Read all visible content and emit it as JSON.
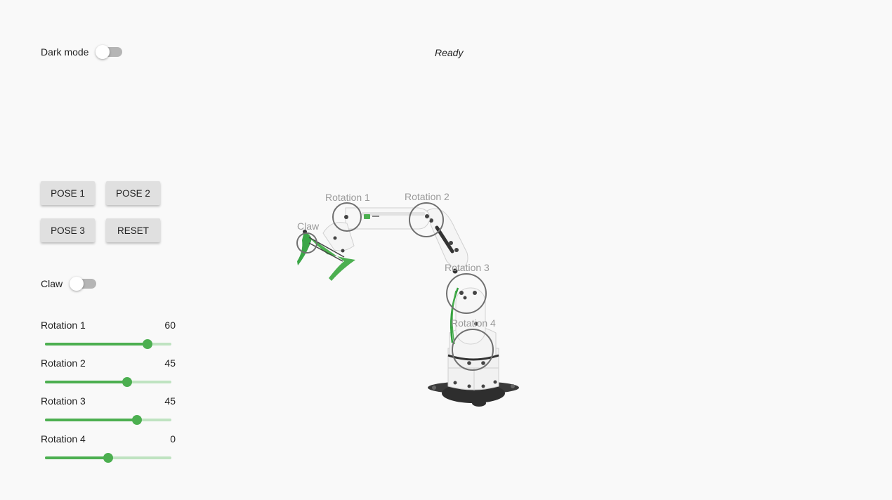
{
  "settings": {
    "dark_mode_label": "Dark mode",
    "dark_mode_on": false
  },
  "status_text": "Ready",
  "poses": {
    "pose1_label": "POSE 1",
    "pose2_label": "POSE 2",
    "pose3_label": "POSE 3",
    "reset_label": "RESET"
  },
  "claw": {
    "label": "Claw",
    "on": false
  },
  "sliders": [
    {
      "label": "Rotation 1",
      "value": "60",
      "fraction": 0.81
    },
    {
      "label": "Rotation 2",
      "value": "45",
      "fraction": 0.65
    },
    {
      "label": "Rotation 3",
      "value": "45",
      "fraction": 0.73
    },
    {
      "label": "Rotation 4",
      "value": "0",
      "fraction": 0.5
    }
  ],
  "robot_labels": {
    "claw": "Claw",
    "rotation1": "Rotation 1",
    "rotation2": "Rotation 2",
    "rotation3": "Rotation 3",
    "rotation4": "Rotation 4"
  },
  "colors": {
    "accent": "#4caf50",
    "accent_light": "#bfe3c1",
    "button_bg": "#e0e0e0",
    "background": "#f9f9f9"
  }
}
